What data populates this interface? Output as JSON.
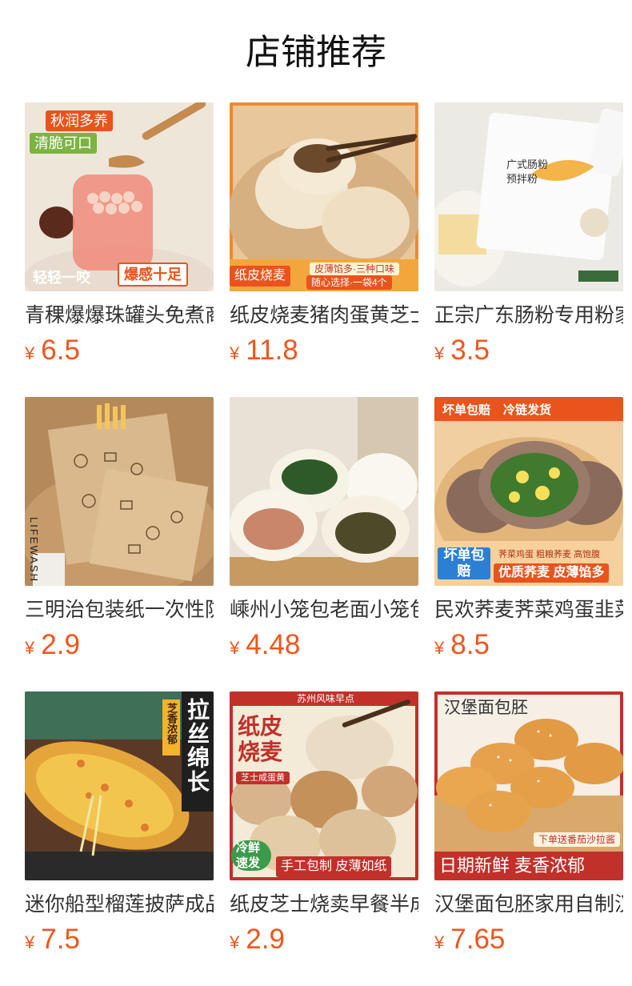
{
  "page": {
    "title": "店铺推荐"
  },
  "currency": "¥",
  "products": [
    {
      "name": "青稞爆爆珠罐头免煮商用",
      "price": "6.5",
      "tags": [
        "秋润多养",
        "清脆可口",
        "轻轻一咬",
        "爆感十足"
      ]
    },
    {
      "name": "纸皮烧麦猪肉蛋黄芝士",
      "price": "11.8",
      "tags": [
        "皮薄馅多·三种口味",
        "随心选择·一袋4个",
        "纸皮烧麦"
      ]
    },
    {
      "name": "正宗广东肠粉专用粉家用",
      "price": "3.5",
      "tags": [
        "广式肠粉",
        "预拌粉"
      ]
    },
    {
      "name": "三明治包装纸一次性防油",
      "price": "2.9",
      "tags": [
        "LIFEWASH"
      ]
    },
    {
      "name": "嵊州小笼包老面小笼包",
      "price": "4.48",
      "tags": []
    },
    {
      "name": "民欢荞麦荠菜鸡蛋韭菜",
      "price": "8.5",
      "tags": [
        "坏单包赔",
        "冷链发货",
        "坏单包赔",
        "荠菜鸡蛋 粗粮荞麦 高饱腹",
        "优质荞麦 皮薄馅多"
      ]
    },
    {
      "name": "迷你船型榴莲披萨成品",
      "price": "7.5",
      "tags": [
        "芝香浓郁",
        "拉丝绵长"
      ]
    },
    {
      "name": "纸皮芝士烧卖早餐半成品",
      "price": "2.9",
      "tags": [
        "苏州风味早点",
        "纸皮烧麦",
        "芝士咸蛋黄",
        "冷鲜速发",
        "手工包制 皮薄如纸"
      ]
    },
    {
      "name": "汉堡面包胚家用自制汉堡",
      "price": "7.65",
      "tags": [
        "汉堡面包胚",
        "下单送番茄沙拉酱",
        "日期新鲜 麦香浓郁"
      ]
    }
  ],
  "colors": {
    "price": "#f2541b",
    "accent": "#e8541c"
  }
}
